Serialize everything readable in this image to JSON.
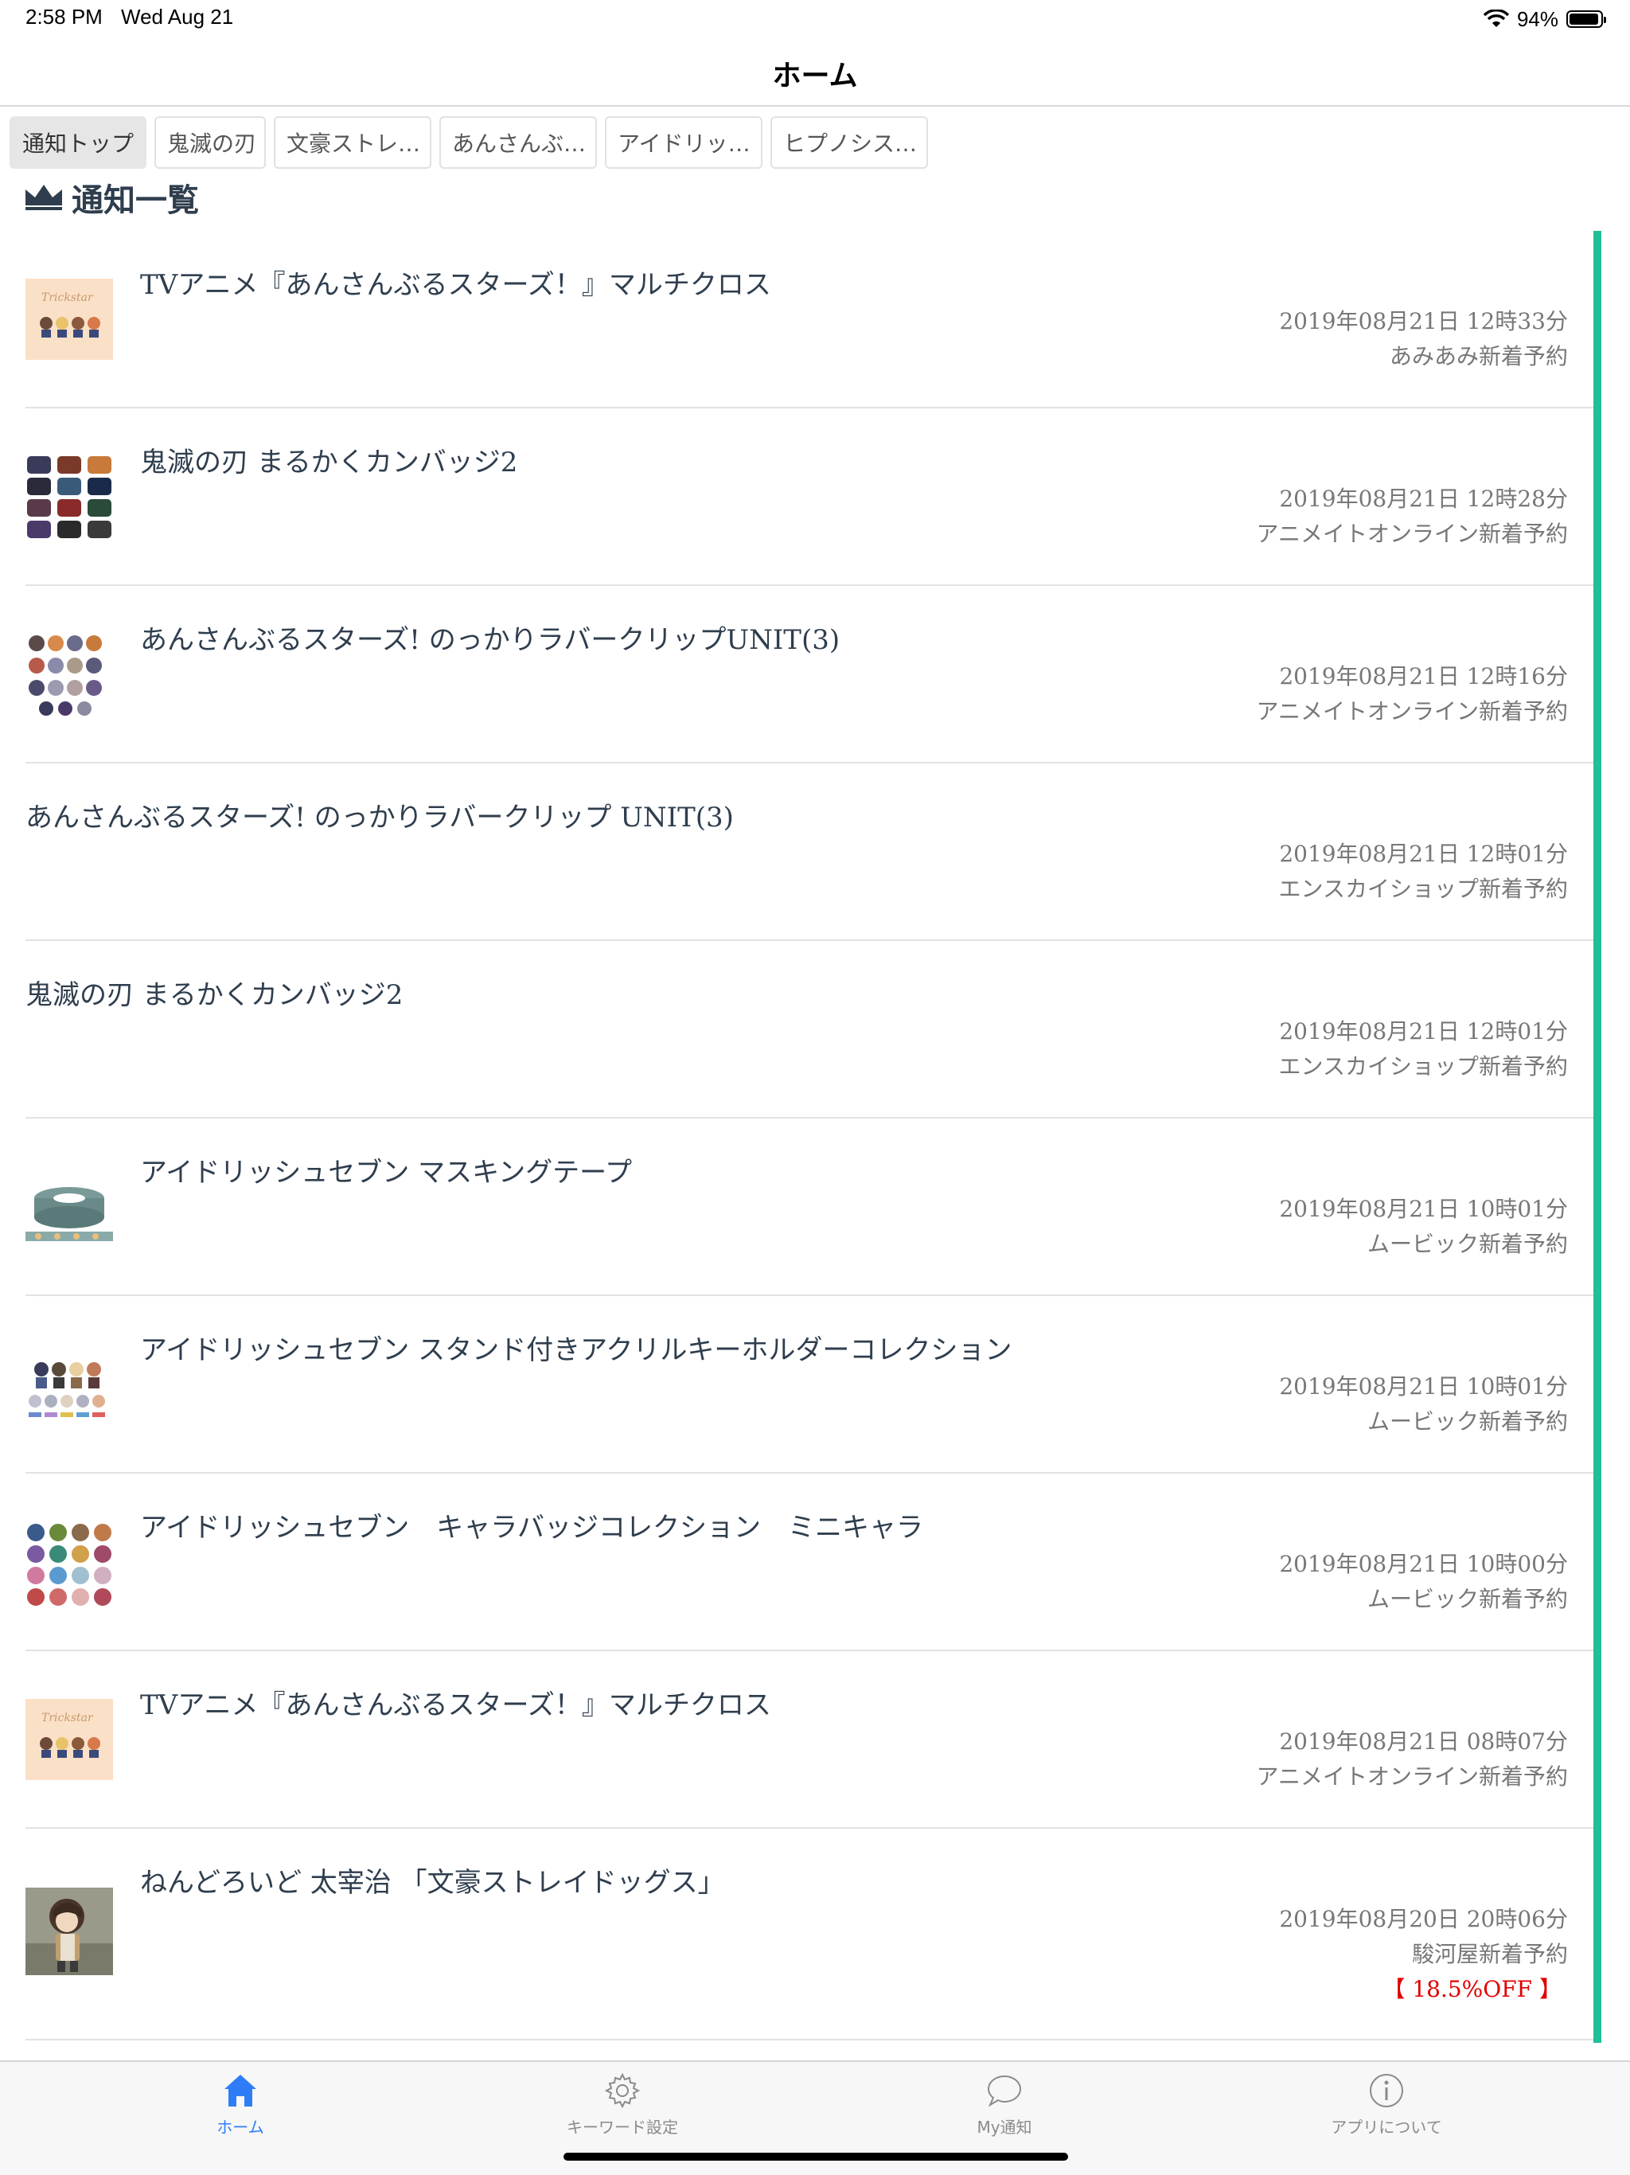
{
  "status_bar": {
    "time": "2:58 PM",
    "date": "Wed Aug 21",
    "battery": "94%",
    "battery_level": 0.94
  },
  "nav": {
    "title": "ホーム"
  },
  "tabs": [
    {
      "label": "通知トップ",
      "active": true
    },
    {
      "label": "鬼滅の刃",
      "active": false
    },
    {
      "label": "文豪ストレ…",
      "active": false
    },
    {
      "label": "あんさんぶ…",
      "active": false
    },
    {
      "label": "アイドリッ…",
      "active": false
    },
    {
      "label": "ヒプノシス…",
      "active": false
    }
  ],
  "section": {
    "title": "通知一覧",
    "icon": "crown-icon"
  },
  "colors": {
    "accent": "#1fbf9a",
    "active_tab": "#2f7df6",
    "discount": "#e00000"
  },
  "items": [
    {
      "title": "TVアニメ『あんさんぶるスターズ！』マルチクロス",
      "date": "2019年08月21日 12時33分",
      "source": "あみあみ新着予約",
      "thumb": "trickstar-cloth"
    },
    {
      "title": "鬼滅の刃 まるかくカンバッジ2",
      "date": "2019年08月21日 12時28分",
      "source": "アニメイトオンライン新着予約",
      "thumb": "badge-grid"
    },
    {
      "title": "あんさんぶるスターズ! のっかりラバークリップUNIT(3)",
      "date": "2019年08月21日 12時16分",
      "source": "アニメイトオンライン新着予約",
      "thumb": "rubber-clips"
    },
    {
      "title": "あんさんぶるスターズ! のっかりラバークリップ UNIT(3)",
      "date": "2019年08月21日 12時01分",
      "source": "エンスカイショップ新着予約",
      "thumb": ""
    },
    {
      "title": "鬼滅の刃 まるかくカンバッジ2",
      "date": "2019年08月21日 12時01分",
      "source": "エンスカイショップ新着予約",
      "thumb": ""
    },
    {
      "title": "アイドリッシュセブン マスキングテープ",
      "date": "2019年08月21日 10時01分",
      "source": "ムービック新着予約",
      "thumb": "masking-tape"
    },
    {
      "title": "アイドリッシュセブン スタンド付きアクリルキーホルダーコレクション",
      "date": "2019年08月21日 10時01分",
      "source": "ムービック新着予約",
      "thumb": "acrylic-keyholders"
    },
    {
      "title": "アイドリッシュセブン　キャラバッジコレクション　ミニキャラ",
      "date": "2019年08月21日 10時00分",
      "source": "ムービック新着予約",
      "thumb": "round-badges"
    },
    {
      "title": "TVアニメ『あんさんぶるスターズ！』マルチクロス",
      "date": "2019年08月21日 08時07分",
      "source": "アニメイトオンライン新着予約",
      "thumb": "trickstar-cloth"
    },
    {
      "title": "ねんどろいど 太宰治 「文豪ストレイドッグス」",
      "date": "2019年08月20日 20時06分",
      "source": "駿河屋新着予約",
      "discount": "【 18.5%OFF 】",
      "thumb": "figure"
    }
  ],
  "tabbar": {
    "items": [
      {
        "label": "ホーム",
        "icon": "home-icon",
        "active": true
      },
      {
        "label": "キーワード設定",
        "icon": "gear-icon",
        "active": false
      },
      {
        "label": "My通知",
        "icon": "chat-bubble-icon",
        "active": false
      },
      {
        "label": "アプリについて",
        "icon": "info-icon",
        "active": false
      }
    ]
  }
}
